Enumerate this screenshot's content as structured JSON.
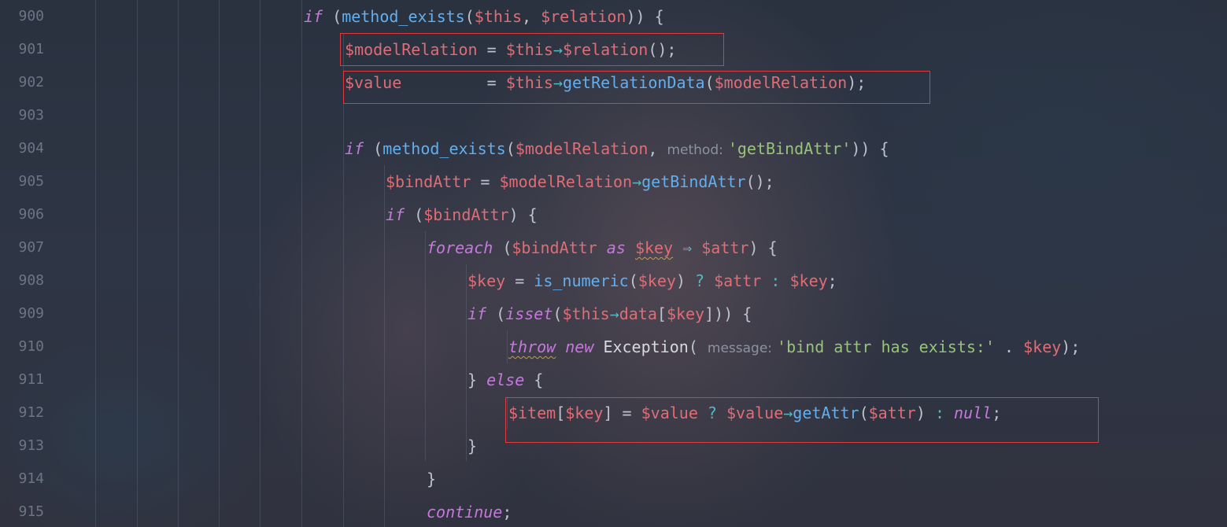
{
  "editor": {
    "line_numbers": [
      "900",
      "901",
      "902",
      "903",
      "904",
      "905",
      "906",
      "907",
      "908",
      "909",
      "910",
      "911",
      "912",
      "913",
      "914",
      "915"
    ],
    "lines": {
      "l900": {
        "kw_if": "if",
        "p1": " (",
        "fn": "method_exists",
        "p2": "(",
        "v1": "$this",
        "p3": ", ",
        "v2": "$relation",
        "p4": ")) {"
      },
      "l901": {
        "v1": "$modelRelation",
        "p1": " = ",
        "v2": "$this",
        "arrow": "→",
        "v3": "$relation",
        "p2": "();"
      },
      "l902": {
        "v1": "$value",
        "p1": "         = ",
        "v2": "$this",
        "arrow": "→",
        "fn": "getRelationData",
        "p2": "(",
        "v3": "$modelRelation",
        "p3": ");"
      },
      "l904": {
        "kw_if": "if",
        "p1": " (",
        "fn": "method_exists",
        "p2": "(",
        "v1": "$modelRelation",
        "p3": ", ",
        "hint": "method:",
        "str": "'getBindAttr'",
        "p4": ")) {"
      },
      "l905": {
        "v1": "$bindAttr",
        "p1": " = ",
        "v2": "$modelRelation",
        "arrow": "→",
        "fn": "getBindAttr",
        "p2": "();"
      },
      "l906": {
        "kw_if": "if",
        "p1": " (",
        "v1": "$bindAttr",
        "p2": ") {"
      },
      "l907": {
        "kw_foreach": "foreach",
        "p1": " (",
        "v1": "$bindAttr",
        "kw_as": " as ",
        "v2": "$key",
        "arrow": " ⇒ ",
        "v3": "$attr",
        "p2": ") {"
      },
      "l908": {
        "v1": "$key",
        "p1": " = ",
        "fn": "is_numeric",
        "p2": "(",
        "v2": "$key",
        "p3": ") ",
        "q": "?",
        "p4": " ",
        "v3": "$attr",
        "p5": " ",
        "c": ":",
        "p6": " ",
        "v4": "$key",
        "p7": ";"
      },
      "l909": {
        "kw_if": "if",
        "p1": " (",
        "kw_isset": "isset",
        "p2": "(",
        "v1": "$this",
        "arrow": "→",
        "fn": "data",
        "p3": "[",
        "v2": "$key",
        "p4": "])) {"
      },
      "l910": {
        "kw_throw": "throw",
        "kw_new": " new ",
        "cls": "Exception",
        "p1": "( ",
        "hint": "message:",
        "str": "'bind attr has exists:'",
        "p2": " . ",
        "v1": "$key",
        "p3": ");"
      },
      "l911": {
        "p1": "} ",
        "kw_else": "else",
        "p2": " {"
      },
      "l912": {
        "v1": "$item",
        "p1": "[",
        "v2": "$key",
        "p2": "] = ",
        "v3": "$value",
        "p3": " ",
        "q": "?",
        "p4": " ",
        "v4": "$value",
        "arrow": "→",
        "fn": "getAttr",
        "p5": "(",
        "v5": "$attr",
        "p6": ") ",
        "c": ":",
        "p7": " ",
        "kw_null": "null",
        "p8": ";"
      },
      "l913": {
        "p1": "}"
      },
      "l914": {
        "p1": "}"
      },
      "l915": {
        "kw_continue": "continue",
        "p1": ";"
      }
    },
    "colors": {
      "keyword": "#c678dd",
      "variable": "#e06c75",
      "function": "#61afef",
      "string": "#98c379",
      "highlight_box": "#e0393e"
    }
  }
}
